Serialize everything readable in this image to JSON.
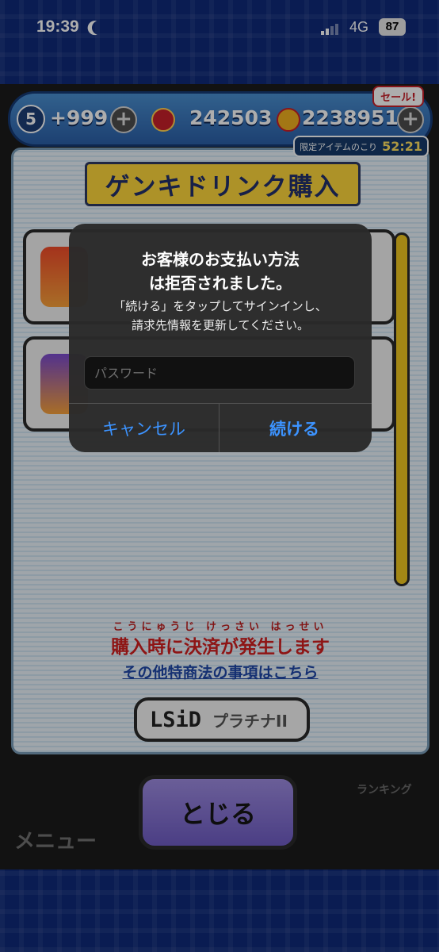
{
  "status_bar": {
    "time": "19:39",
    "network": "4G",
    "battery": "87"
  },
  "currency": {
    "stamina_level": "5",
    "stamina_value": "+999",
    "yen_value": "242503",
    "premium_value": "2238951",
    "sale_badge": "セール!",
    "limited_label": "限定アイテムのこり",
    "limited_time": "52:21"
  },
  "panel": {
    "title": "ゲンキドリンク購入",
    "ruby": "こうにゅうじ けっさい はっせい",
    "warning": "購入時に決済が発生します",
    "law_link": "その他特商法の事項はこちら",
    "lsid_logo": "LSiD",
    "platinum_label": "プラチナII"
  },
  "bottom": {
    "close_label": "とじる",
    "menu_label": "メニュー",
    "ranking_label": "ランキング"
  },
  "alert": {
    "title_line1": "お客様のお支払い方法",
    "title_line2": "は拒否されました。",
    "message_line1": "「続ける」をタップしてサインインし、",
    "message_line2": "請求先情報を更新してください。",
    "password_placeholder": "パスワード",
    "cancel_label": "キャンセル",
    "continue_label": "続ける"
  },
  "colors": {
    "alert_button": "#3c93ff",
    "warning_red": "#d11f20",
    "title_yellow": "#ffd83b",
    "close_purple": "#7f6cd0",
    "scroll_yellow": "#f0c720"
  },
  "icons": [
    "moon-icon",
    "signal-icon",
    "plus-icon",
    "yen-coin-icon",
    "gold-coin-icon",
    "drink-icon"
  ]
}
